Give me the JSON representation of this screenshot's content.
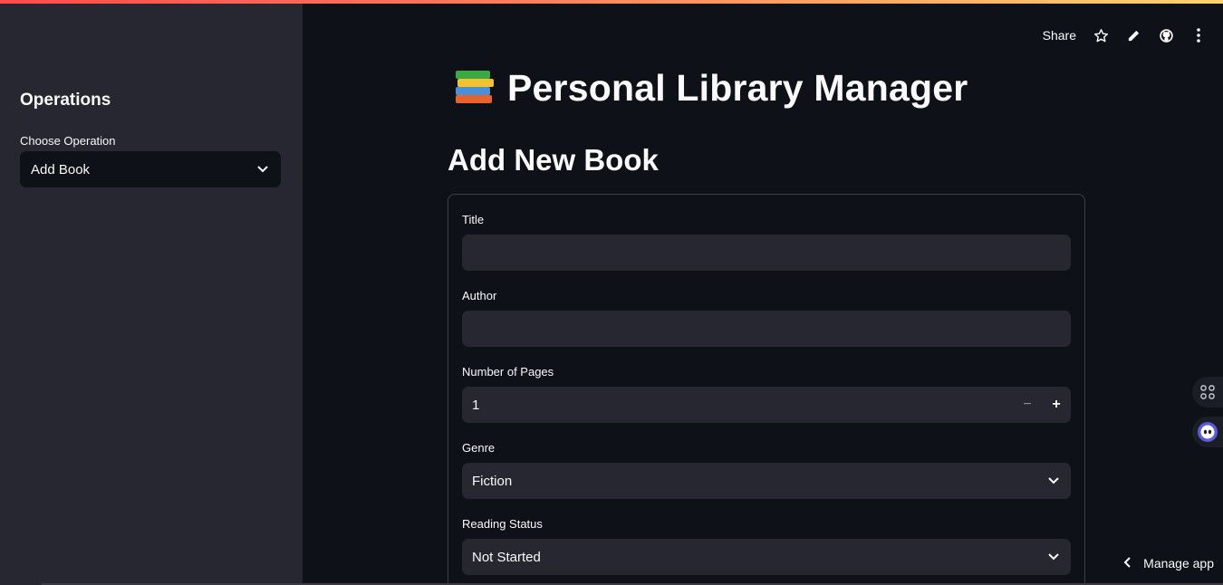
{
  "sidebar": {
    "title": "Operations",
    "select_label": "Choose Operation",
    "select_value": "Add Book"
  },
  "toolbar": {
    "share_label": "Share",
    "icons": [
      "star-icon",
      "pencil-icon",
      "github-icon",
      "kebab-menu-icon"
    ]
  },
  "page": {
    "title": "Personal Library Manager",
    "title_icon": "books-icon",
    "section_title": "Add New Book"
  },
  "form": {
    "title_label": "Title",
    "title_value": "",
    "author_label": "Author",
    "author_value": "",
    "pages_label": "Number of Pages",
    "pages_value": "1",
    "minus": "−",
    "plus": "+",
    "genre_label": "Genre",
    "genre_value": "Fiction",
    "status_label": "Reading Status",
    "status_value": "Not Started"
  },
  "footer": {
    "manage_label": "Manage app"
  },
  "colors": {
    "background": "#0e1117",
    "sidebar": "#262730",
    "input": "#262730",
    "text": "#fafafa"
  }
}
